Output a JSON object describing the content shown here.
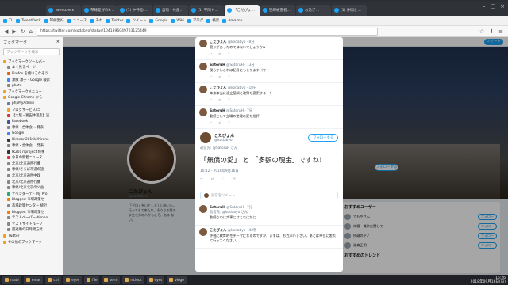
{
  "browser": {
    "tabs": [
      {
        "label": "TweetDeck",
        "active": false
      },
      {
        "label": "琴線愛好のkanasan",
        "active": false
      },
      {
        "label": "(1) 中神睦(Kabe-Bi",
        "active": false
      },
      {
        "label": "自衛・共産党投票セン",
        "active": false
      },
      {
        "label": "(1) 平岡トミ さんは",
        "active": false
      },
      {
        "label": "「こだびょん」さんのツイート",
        "active": true
      },
      {
        "label": "犯罪被害者…",
        "active": false
      },
      {
        "label": "お急ぎ…",
        "active": false
      },
      {
        "label": "(1) 仲間と寝る話",
        "active": false
      }
    ],
    "bookmarks_bar": [
      "TL",
      "TweetDeck",
      "琴線愛好",
      "ニュース",
      "あれ",
      "Twitter",
      "ツイート",
      "Google",
      "Wiki",
      "ブログ",
      "検索",
      "Amazon"
    ],
    "url": "https://twitter.com/kodabyo/status/1041896049703125449",
    "nav_icons": {
      "back": "◀",
      "forward": "▶",
      "reload": "↻",
      "home": "⌂"
    }
  },
  "sidebar": {
    "title": "ブックマーク",
    "close": "×",
    "search_placeholder": "ブックマークを検索",
    "items": [
      {
        "label": "ブックマークツールバー",
        "level": 0,
        "color": "#f0a31f"
      },
      {
        "label": "よく見るページ",
        "level": 1,
        "color": "#888"
      },
      {
        "label": "Firefox を使いこなそう",
        "level": 1,
        "color": "#e66000"
      },
      {
        "label": "源獣 源子 - Google 検索",
        "level": 1,
        "color": "#4285f4"
      },
      {
        "label": "photo",
        "level": 1,
        "color": "#888"
      },
      {
        "label": "ブックマークメニュー",
        "level": 0,
        "color": "#f0a31f"
      },
      {
        "label": "Google Chrome から",
        "level": 0,
        "color": "#f0a31f"
      },
      {
        "label": "phpMyAdmin",
        "level": 1,
        "color": "#6c78af"
      },
      {
        "label": "ブログサービス(ゴ",
        "level": 1,
        "color": "#f0a31f"
      },
      {
        "label": "【大阪・富田林逃走】逃",
        "level": 1,
        "color": "#d33"
      },
      {
        "label": "Facebook",
        "level": 1,
        "color": "#3b5998"
      },
      {
        "label": "専修・合体会… 発表",
        "level": 1,
        "color": "#888"
      },
      {
        "label": "Google",
        "level": 1,
        "color": "#4285f4"
      },
      {
        "label": "Hironori2016ki/hirono",
        "level": 1,
        "color": "#333"
      },
      {
        "label": "専修・合体会… 発表",
        "level": 1,
        "color": "#888"
      },
      {
        "label": "fk2017/project 時事",
        "level": 1,
        "color": "#333"
      },
      {
        "label": "今日の新着ニュース",
        "level": 1,
        "color": "#d33"
      },
      {
        "label": "北京/北京通用行機",
        "level": 1,
        "color": "#888"
      },
      {
        "label": "専修/さらば市道の話",
        "level": 1,
        "color": "#888"
      },
      {
        "label": "北京/北京通用中政",
        "level": 1,
        "color": "#888"
      },
      {
        "label": "北京/北京通用行機",
        "level": 1,
        "color": "#888"
      },
      {
        "label": "専修/北京北京の公益",
        "level": 1,
        "color": "#888"
      },
      {
        "label": "デベンダーデ - My Pro",
        "level": 1,
        "color": "#2a7"
      },
      {
        "label": "Blogger: 市場政策セ",
        "level": 1,
        "color": "#f57d00"
      },
      {
        "label": "市場政策センター 統計",
        "level": 1,
        "color": "#888"
      },
      {
        "label": "Blogger: 市場政策セ",
        "level": 1,
        "color": "#f57d00"
      },
      {
        "label": "テストペーパー-hirono",
        "level": 1,
        "color": "#888"
      },
      {
        "label": "テストサイトループ",
        "level": 1,
        "color": "#888"
      },
      {
        "label": "最適用の日時間方式",
        "level": 1,
        "color": "#888"
      },
      {
        "label": "Twitter",
        "level": 0,
        "color": "#f0a31f"
      },
      {
        "label": "その他のブックマーク",
        "level": 0,
        "color": "#f0a31f"
      }
    ]
  },
  "profile": {
    "name": "こたびょん",
    "handle": "@kodabyo",
    "bio": "「ゼロ」をいとしとしい歩いた。行ってきて来たり、そうなる限のよ生き方の人からこそ、ある ない。",
    "tweet_button": "ツイート",
    "follow_label": "フォローする"
  },
  "recommendations": {
    "title": "おすすめユーザー",
    "users": [
      {
        "name": "でもやさん",
        "follow": "フォロー"
      },
      {
        "name": "岸壇-- 美砂に関して",
        "follow": "フォロー"
      },
      {
        "name": "所蔵のヤノ",
        "follow": "フォロー"
      },
      {
        "name": "福森正明",
        "follow": "フォロー"
      }
    ],
    "trends_title": "おすすめのトレンド"
  },
  "modal": {
    "replies_top": [
      {
        "name": "こたびょん",
        "handle": "@kodabyo · 8分",
        "text": "競りがあったのではないでしょうかw"
      },
      {
        "name": "SatoruH",
        "handle": "@SatoruH · 13分",
        "text": "僕らかしこれは記号にもとります（ㄘ"
      },
      {
        "name": "こたびょん",
        "handle": "@kodabyo · 18分",
        "text": "本来本当に達立基調と政策を変更する！！"
      },
      {
        "name": "SatoruH",
        "handle": "@SatoruH · 7分",
        "text": "勤続として立場の整理の変を批評"
      }
    ],
    "main": {
      "name": "こたびょん",
      "handle": "@kodabyo",
      "reply_to": "返信先: @SatoruH さん",
      "follow": "フォローする",
      "text": "「無償の愛」 と 「多額の現金」ですね！",
      "time": "10:12 - 2018年9月16日",
      "stats": [
        "↩",
        "⇄",
        "♡",
        "✉"
      ]
    },
    "reply_placeholder": "返信をツイート",
    "replies_bottom": [
      {
        "name": "SatoruH",
        "handle": "@SatoruH · 7分",
        "reply_to": "返信先: @kodabyo さん",
        "text": "勤続なのに大事にはこれにかに"
      },
      {
        "name": "こたびょん",
        "handle": "@kodabyo · 42秒",
        "reply_to": "",
        "text": "評価に教育的モデーマになるのですが、まずは、お力添い下さい。あとは単位に差れて行ってください。"
      }
    ]
  },
  "taskbar": {
    "items": [
      "mate",
      "emac",
      "ctrl",
      "eyes",
      "file",
      "term",
      "rtclock",
      "eyes",
      "vlogo"
    ],
    "clock_time": "16:26",
    "clock_date": "2018年09月16日(日)"
  }
}
